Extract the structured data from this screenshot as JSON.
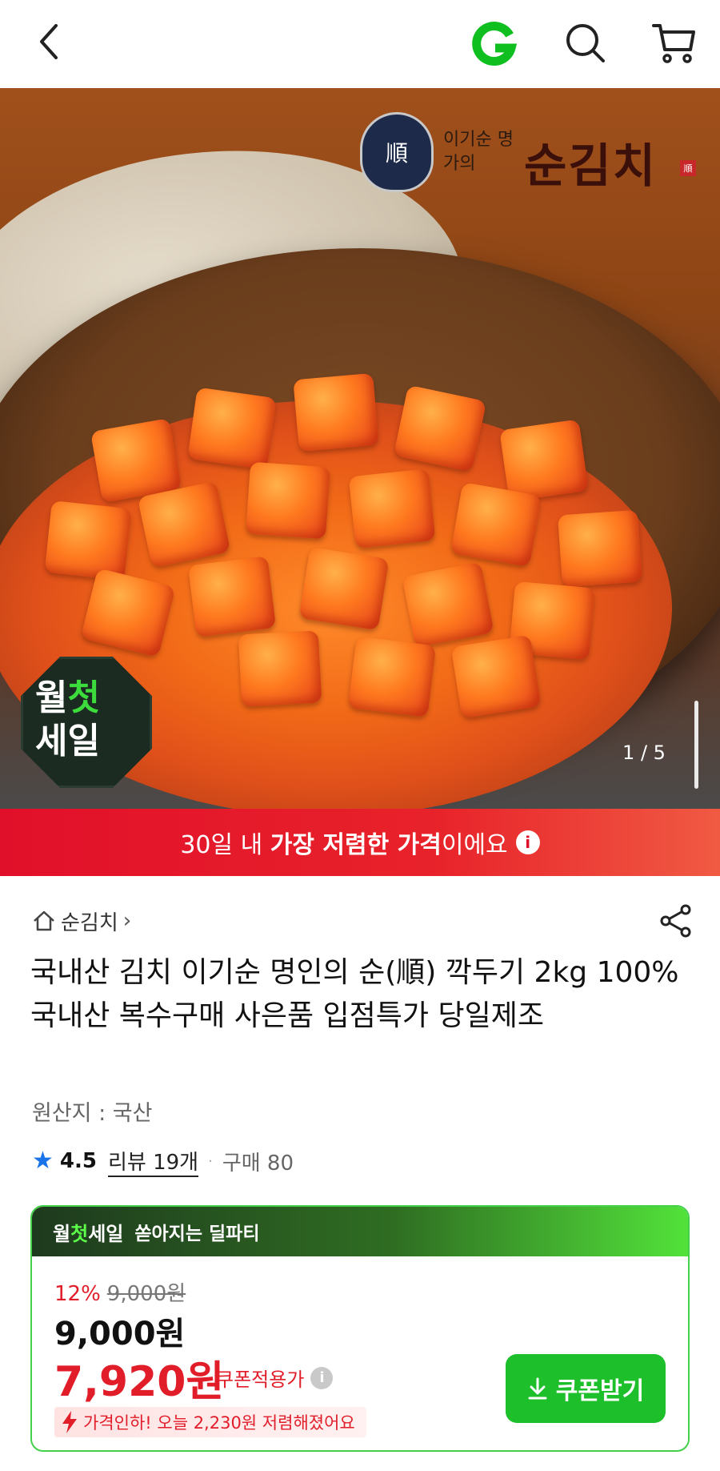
{
  "topbar": {
    "logo_letter": "G"
  },
  "hero": {
    "brand_sub": "이기순 명가의",
    "brand_main": "순김치",
    "brand_seal": "順",
    "brand_mini": "順",
    "sale_badge_line1_a": "월",
    "sale_badge_line1_b": "첫",
    "sale_badge_line2": "세일",
    "pager": "1 / 5"
  },
  "price_banner": {
    "pre": "30일 내 ",
    "bold": "가장 저렴한 가격",
    "post": "이에요",
    "info": "i"
  },
  "product": {
    "store": "순김치",
    "store_chevron": "›",
    "title": "국내산 김치 이기순 명인의 순(順) 깍두기 2kg 100% 국내산 복수구매 사은품 입점특가 당일제조",
    "origin": "원산지 : 국산",
    "rating": "4.5",
    "review": "리뷰 19개",
    "separator": "·",
    "buys": "구매 80"
  },
  "deal": {
    "brand_a": "월",
    "brand_b": "첫",
    "brand_c": "세일",
    "headline": "쏟아지는 딜파티",
    "discount_rate": "12%",
    "original_price": "9,000원",
    "sale_price": "9,000원",
    "coupon_price": "7,920원",
    "coupon_label": "쿠폰적용가",
    "coupon_info": "i",
    "price_drop": "가격인하! 오늘 2,230원 저렴해졌어요",
    "coupon_button": "쿠폰받기"
  },
  "colors": {
    "brand_green": "#1dbf2a",
    "sale_red": "#e11d2a",
    "rating_star": "#1a73e8"
  },
  "icons": [
    "back-arrow-icon",
    "g-logo-icon",
    "search-icon",
    "cart-icon",
    "home-icon",
    "share-icon",
    "star-icon",
    "info-icon",
    "bolt-icon",
    "download-icon"
  ]
}
